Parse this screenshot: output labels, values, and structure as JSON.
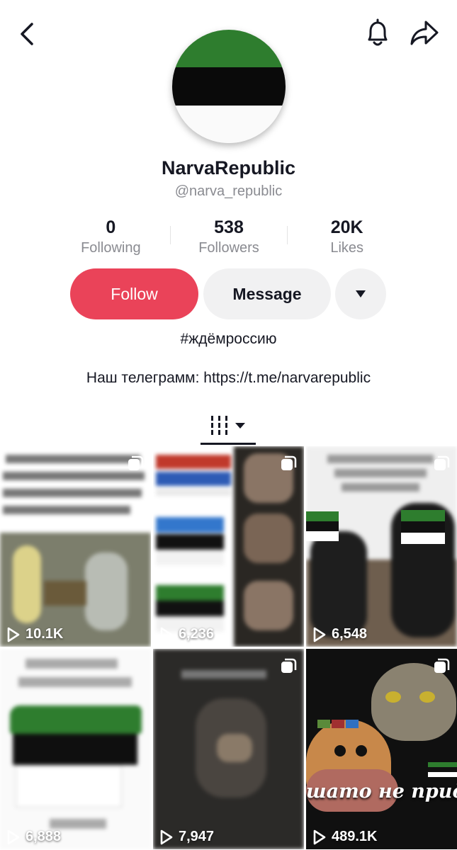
{
  "header": {
    "back_icon": "chevron-left-icon",
    "notify_icon": "bell-icon",
    "share_icon": "share-arrow-icon"
  },
  "profile": {
    "display_name": "NarvaRepublic",
    "handle": "@narva_republic",
    "avatar_colors": [
      "#2e7d2e",
      "#0a0a0a",
      "#ffffff"
    ]
  },
  "stats": [
    {
      "value": "0",
      "label": "Following"
    },
    {
      "value": "538",
      "label": "Followers"
    },
    {
      "value": "20K",
      "label": "Likes"
    }
  ],
  "actions": {
    "follow_label": "Follow",
    "message_label": "Message",
    "more_icon": "caret-down-icon"
  },
  "bio": {
    "hashtag": "#ждёмроссию",
    "telegram": "Наш телеграмм: https://t.me/narvarepublic"
  },
  "tabs": {
    "grid_icon": "video-grid-icon"
  },
  "colors": {
    "accent": "#ea4359",
    "muted_text": "#8a8b91",
    "button_bg": "#f1f1f2"
  },
  "videos": [
    {
      "views": "10.1K",
      "multi": true
    },
    {
      "views": "6,236",
      "multi": true
    },
    {
      "views": "6,548",
      "multi": true
    },
    {
      "views": "6,888",
      "multi": false
    },
    {
      "views": "7,947",
      "multi": true
    },
    {
      "views": "489.1K",
      "multi": true,
      "caption": "шато не придё"
    }
  ]
}
